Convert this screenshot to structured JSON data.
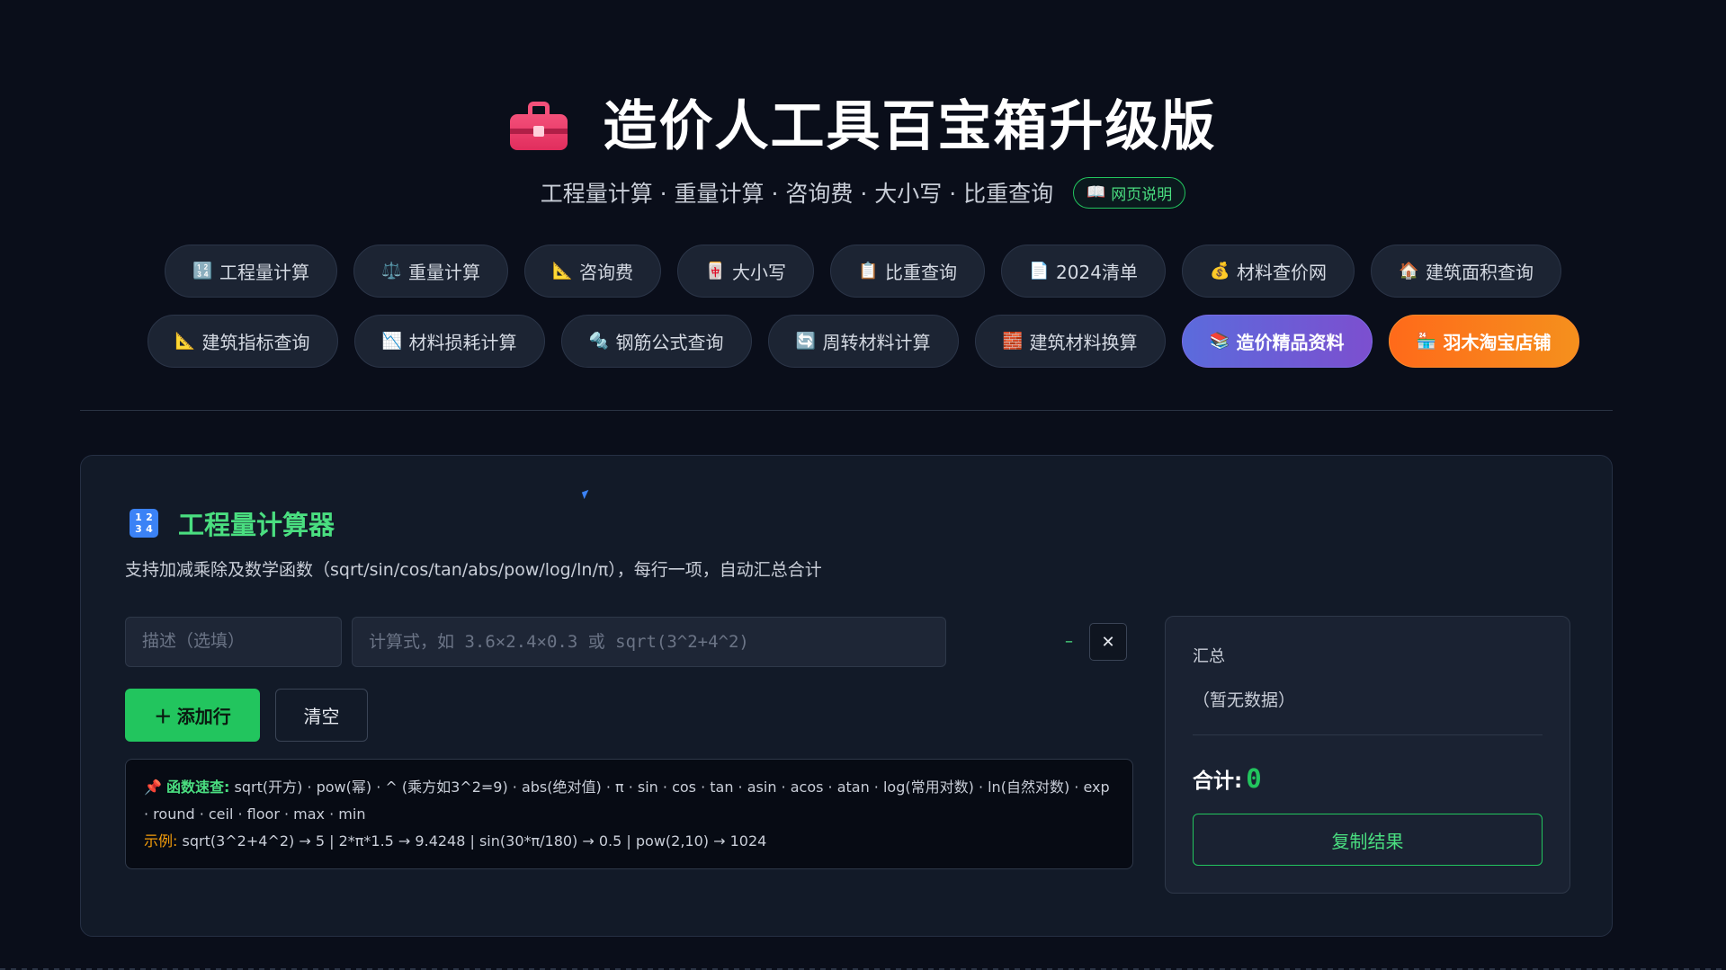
{
  "header": {
    "icon": "toolbox-icon",
    "title": "造价人工具百宝箱升级版",
    "subtitle": "工程量计算 · 重量计算 · 咨询费 · 大小写 · 比重查询",
    "help_label": "网页说明",
    "help_icon": "📖"
  },
  "nav_row1": [
    {
      "icon": "🔢",
      "label": "工程量计算"
    },
    {
      "icon": "⚖️",
      "label": "重量计算"
    },
    {
      "icon": "📐",
      "label": "咨询费"
    },
    {
      "icon": "🀄",
      "label": "大小写"
    },
    {
      "icon": "📋",
      "label": "比重查询"
    },
    {
      "icon": "📄",
      "label": "2024清单"
    },
    {
      "icon": "💰",
      "label": "材料查价网"
    },
    {
      "icon": "🏠",
      "label": "建筑面积查询"
    }
  ],
  "nav_row2": [
    {
      "icon": "📐",
      "label": "建筑指标查询"
    },
    {
      "icon": "📉",
      "label": "材料损耗计算"
    },
    {
      "icon": "🔩",
      "label": "钢筋公式查询"
    },
    {
      "icon": "🔄",
      "label": "周转材料计算"
    },
    {
      "icon": "🧱",
      "label": "建筑材料换算"
    },
    {
      "icon": "📚",
      "label": "造价精品资料"
    },
    {
      "icon": "🏪",
      "label": "羽木淘宝店铺"
    }
  ],
  "calculator": {
    "icon_digits": [
      "1",
      "2",
      "3",
      "4"
    ],
    "title": "工程量计算器",
    "description": "支持加减乘除及数学函数（sqrt/sin/cos/tan/abs/pow/log/ln/π），每行一项，自动汇总合计",
    "row": {
      "desc_placeholder": "描述（选填）",
      "expr_placeholder": "计算式，如 3.6×2.4×0.3 或 sqrt(3^2+4^2)",
      "result": "–",
      "delete_label": "✕"
    },
    "add_label": "＋ 添加行",
    "clear_label": "清空",
    "cheatsheet": {
      "pin": "📌",
      "label": "函数速查:",
      "text": "sqrt(开方) · pow(幂) · ^ (乘方如3^2=9) · abs(绝对值) · π · sin · cos · tan · asin · acos · atan · log(常用对数) · ln(自然对数) · exp · round · ceil · floor · max · min",
      "example_label": "示例:",
      "example_text": "sqrt(3^2+4^2) → 5  |  2*π*1.5 → 9.4248  |  sin(30*π/180) → 0.5  |  pow(2,10) → 1024"
    }
  },
  "summary": {
    "heading": "汇总",
    "empty_text": "（暂无数据）",
    "total_label": "合计:",
    "total_value": "0",
    "copy_label": "复制结果"
  },
  "colors": {
    "accent_green": "#22c55e",
    "purple_pill": "#6d5fd6",
    "orange_pill": "#f97316",
    "background": "#0a0e1a"
  }
}
